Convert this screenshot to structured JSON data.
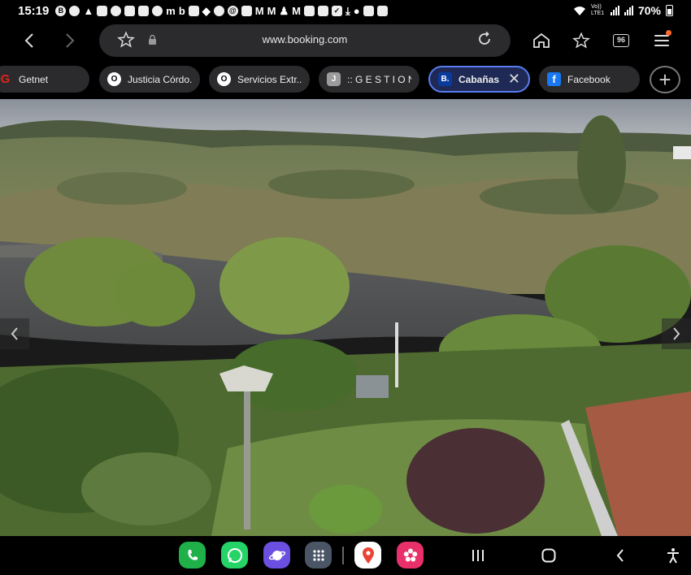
{
  "status_bar": {
    "time": "15:19",
    "network_label": "Vo)) LTE1",
    "battery": "70%",
    "notification_icons": [
      "b-icon",
      "message-icon",
      "warning-icon",
      "mail-icon",
      "circle-icon",
      "mail-icon",
      "mail-icon",
      "circle-icon",
      "m-icon",
      "b-icon",
      "qr-icon",
      "binance-icon",
      "slash-icon",
      "at-icon",
      "snap-icon",
      "gmail-icon",
      "gmail-icon",
      "person-icon",
      "gmail-icon",
      "snap-icon",
      "snap-icon",
      "check-icon",
      "download-icon",
      "location-icon",
      "image-icon",
      "calendar-icon"
    ]
  },
  "toolbar": {
    "back_icon": "chevron-left-icon",
    "forward_icon": "chevron-right-icon",
    "url": "www.booking.com",
    "bookmark_icon": "star-icon",
    "lock_icon": "lock-icon",
    "reload_icon": "reload-icon",
    "home_icon": "home-icon",
    "bookmarks_icon": "star-plus-icon",
    "tab_count": "96",
    "menu_icon": "menu-icon",
    "accent_color": "#ff6a2b"
  },
  "tabs": [
    {
      "label": "Getnet",
      "favicon": "G",
      "favicon_color": "#e2231a"
    },
    {
      "label": "Justicia Córdo...",
      "favicon": "O",
      "favicon_color": "#ffffff"
    },
    {
      "label": "Servicios Extr...",
      "favicon": "O",
      "favicon_color": "#ffffff"
    },
    {
      "label": ":: G E S T I O N...",
      "favicon": "J",
      "favicon_color": "#9c9c9c"
    },
    {
      "label": "Cabañas ...",
      "favicon": "B.",
      "favicon_color": "#0a3a9c",
      "active": true
    },
    {
      "label": "Facebook",
      "favicon": "f",
      "favicon_color": "#1877f2"
    }
  ],
  "content": {
    "image": "river-landscape-photo",
    "prev_icon": "chevron-left-icon",
    "next_icon": "chevron-right-icon"
  },
  "dock": {
    "apps": [
      "phone-app",
      "whatsapp-app",
      "internet-app",
      "apps-grid",
      "maps-app",
      "photos-app"
    ],
    "nav": [
      "recents-icon",
      "home-icon",
      "back-icon",
      "accessibility-icon"
    ]
  }
}
